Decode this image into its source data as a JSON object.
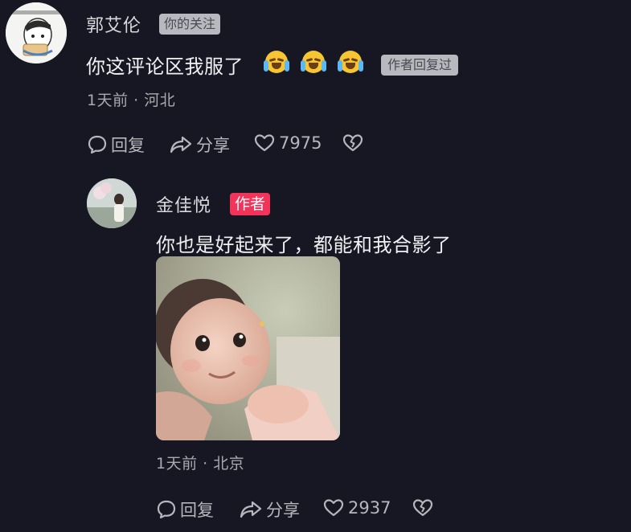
{
  "comment": {
    "username": "郭艾伦",
    "follow_tag": "你的关注",
    "text": "你这评论区我服了",
    "emoji": "crying-laughing-emoji",
    "replied_tag": "作者回复过",
    "meta": "1天前 · 河北",
    "actions": {
      "reply": "回复",
      "share": "分享",
      "likes": "7975"
    }
  },
  "reply": {
    "username": "金佳悦",
    "author_tag": "作者",
    "text": "你也是好起来了，都能和我合影了",
    "meta": "1天前 · 北京",
    "actions": {
      "reply": "回复",
      "share": "分享",
      "likes": "2937"
    }
  },
  "colors": {
    "background": "#161722",
    "author_tag": "#f2335a",
    "tag_gray": "#b8b8bf"
  }
}
